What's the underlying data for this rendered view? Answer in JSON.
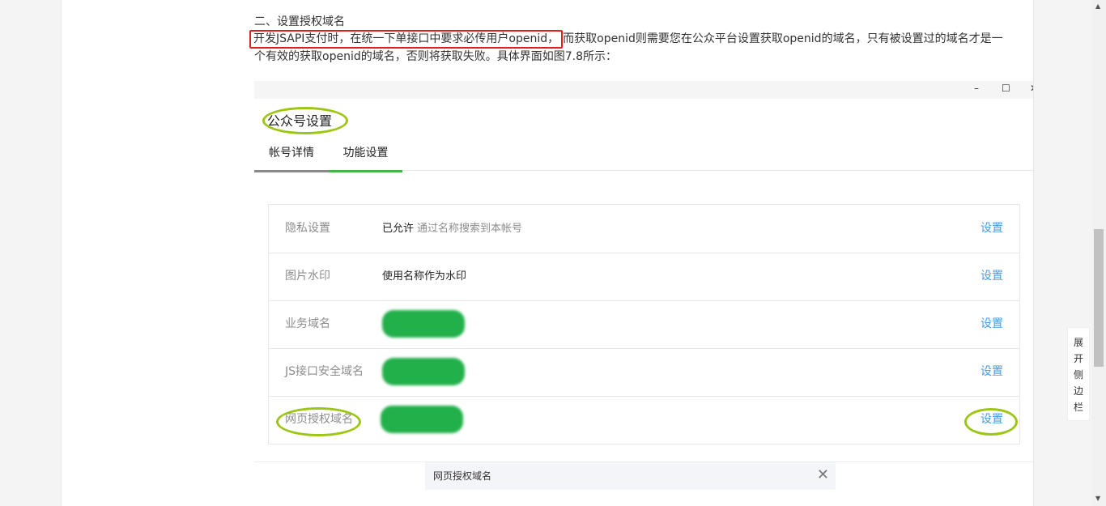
{
  "article": {
    "section_title": "二、设置授权域名",
    "para_highlight": "开发JSAPI支付时，在统一下单接口中要求必传用户openid，",
    "para_rest": "而获取openid则需要您在公众平台设置获取openid的域名，只有被设置过的域名才是一个有效的获取openid的域名，否则将获取失败。具体界面如图7.8所示："
  },
  "screenshot": {
    "window_controls": {
      "minimize": "–",
      "maximize": "☐",
      "close": "✕"
    },
    "title": "公众号设置",
    "tabs": [
      {
        "label": "帐号详情"
      },
      {
        "label": "功能设置"
      }
    ],
    "rows": [
      {
        "label": "隐私设置",
        "value": "已允许",
        "hint": "通过名称搜索到本帐号",
        "action": "设置"
      },
      {
        "label": "图片水印",
        "value": "使用名称作为水印",
        "action": "设置"
      },
      {
        "label": "业务域名",
        "action": "设置"
      },
      {
        "label": "JS接口安全域名",
        "action": "设置"
      },
      {
        "label": "网页授权域名",
        "action": "设置"
      }
    ],
    "tooltip": {
      "text": "网页授权域名",
      "close": "✕"
    },
    "colors": {
      "accent": "#44b549",
      "link": "#459ae9",
      "highlight_red": "#e02020",
      "annotation_green": "#9dc614"
    }
  },
  "sidebar_toggle": {
    "chars": [
      "展",
      "开",
      "侧",
      "边",
      "栏"
    ]
  },
  "scrollbar": {
    "up": "▲",
    "down": "▼"
  }
}
